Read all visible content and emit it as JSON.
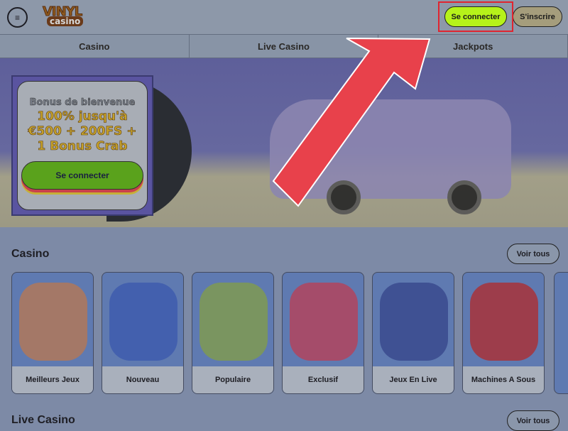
{
  "header": {
    "logo_text": "VINYL casino",
    "login_label": "Se connecter",
    "signup_label": "S'inscrire",
    "menu_icon": "menu-search-icon"
  },
  "nav": {
    "items": [
      {
        "label": "Casino"
      },
      {
        "label": "Live Casino"
      },
      {
        "label": "Jackpots"
      }
    ]
  },
  "promo": {
    "subtitle": "Bonus de bienvenue",
    "offer": "100% jusqu'à €500 + 200FS + 1 Bonus Crab",
    "button_label": "Se connecter"
  },
  "casino": {
    "title": "Casino",
    "see_all": "Voir tous",
    "cards": [
      {
        "label": "Meilleurs Jeux",
        "color": "#b0785a"
      },
      {
        "label": "Nouveau",
        "color": "#3e5cae"
      },
      {
        "label": "Populaire",
        "color": "#7f9a52"
      },
      {
        "label": "Exclusif",
        "color": "#b2445e"
      },
      {
        "label": "Jeux En Live",
        "color": "#3a4a8e"
      },
      {
        "label": "Machines A Sous",
        "color": "#a8323a"
      }
    ]
  },
  "live_casino": {
    "title": "Live Casino",
    "see_all": "Voir tous"
  },
  "overlay": {
    "highlight_color": "#e0242f",
    "arrow_color": "#e8414b"
  }
}
